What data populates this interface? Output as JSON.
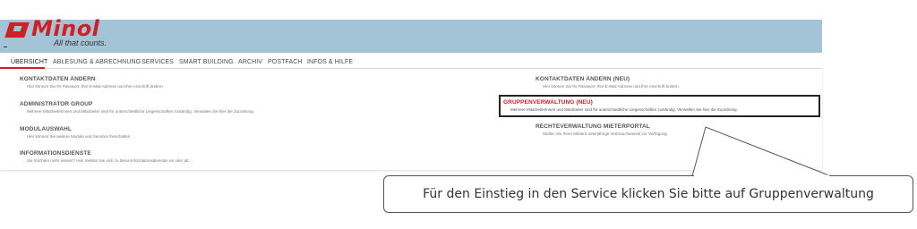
{
  "brand": {
    "name": "Minol",
    "tagline": "All that counts.",
    "logo_color": "#d21f25",
    "header_color": "#a3c3d6"
  },
  "nav": {
    "items": [
      "ÜBERSICHT",
      "ABLESUNG & ABRECHNUNG",
      "SERVICES",
      "SMART BUILDING",
      "ARCHIV",
      "POSTFACH",
      "INFOS & HILFE"
    ],
    "active": "ÜBERSICHT"
  },
  "left_column": [
    {
      "title": "KONTAKTDATEN ÄNDERN",
      "desc": "Hier können Sie Ihr Passwort, Ihre E-Mail Adresse und Ihre Anschrift ändern."
    },
    {
      "title": "ADMINISTRATOR GROUP",
      "desc": "Mehrere Mitarbeiterinnen und Mitarbeiter sind für unterschiedliche Liegenschaften zuständig. Verwalten Sie hier die Zuordnung."
    },
    {
      "title": "MODULAUSWAHL",
      "desc": "Hier können Sie weitere Module und Services freischalten"
    },
    {
      "title": "INFORMATIONSDIENSTE",
      "desc": "Sie möchten mehr wissen? Hier melden Sie sich zu Minol-Informationsdiensten an oder ab."
    }
  ],
  "right_column": [
    {
      "title": "KONTAKTDATEN ÄNDERN (NEU)",
      "desc": "Hier können Sie Ihr Passwort, Ihre E-Mail Adresse und Ihre Anschrift ändern."
    },
    {
      "title": "GRUPPENVERWALTUNG (NEU)",
      "desc": "Mehrere Mitarbeiterinnen und Mitarbeiter sind für unterschiedliche Liegenschaften zuständig. Verwalten Sie hier die Zuordnung."
    },
    {
      "title": "RECHTEVERWALTUNG MIETERPORTAL",
      "desc": "Stellen Sie Ihren Mietern unterjährige Verbrauchswerte zur Verfügung."
    }
  ],
  "highlight_color": "#d21f25",
  "callout": {
    "text": "Für den Einstieg in den Service klicken Sie bitte auf Gruppenverwaltung"
  }
}
